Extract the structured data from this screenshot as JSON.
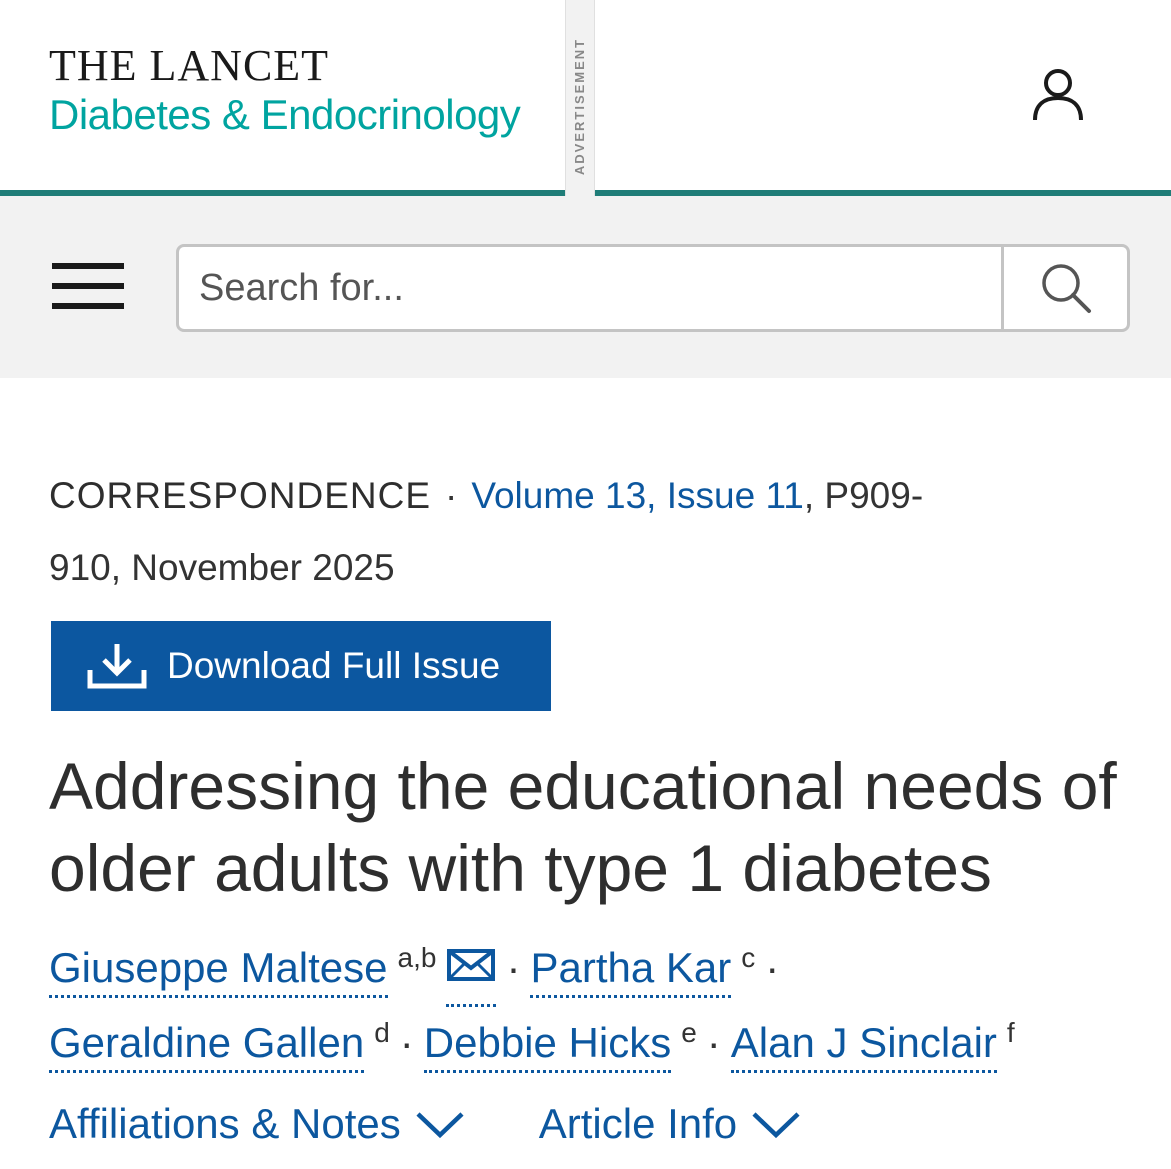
{
  "header": {
    "journal_top": "THE LANCET",
    "journal_bottom": "Diabetes & Endocrinology",
    "ad_label": "ADVERTISEMENT",
    "brand_teal": "#00a4a0",
    "rule_color": "#1f7d78"
  },
  "nav": {
    "search_placeholder": "Search for..."
  },
  "article": {
    "type": "CORRESPONDENCE",
    "volume_issue": "Volume 13, Issue 11",
    "pages_date_part1": ", P909-",
    "pages_date_part2": "910, November 2025",
    "download_label": "Download Full Issue",
    "title": "Addressing the educational needs of older adults with type 1 diabetes",
    "link_color": "#0c579f",
    "button_color": "#0c57a0"
  },
  "authors": [
    {
      "name": "Giuseppe Maltese",
      "sup": "a,b"
    },
    {
      "name": "Partha Kar",
      "sup": "c"
    },
    {
      "name": "Geraldine Gallen",
      "sup": "d"
    },
    {
      "name": "Debbie Hicks",
      "sup": "e"
    },
    {
      "name": "Alan J Sinclair",
      "sup": "f"
    }
  ],
  "tabs": {
    "affiliations": "Affiliations & Notes",
    "article_info": "Article Info"
  },
  "icons": [
    "user-icon",
    "hamburger-menu-icon",
    "search-icon",
    "download-icon",
    "mail-icon",
    "chevron-down-icon"
  ]
}
